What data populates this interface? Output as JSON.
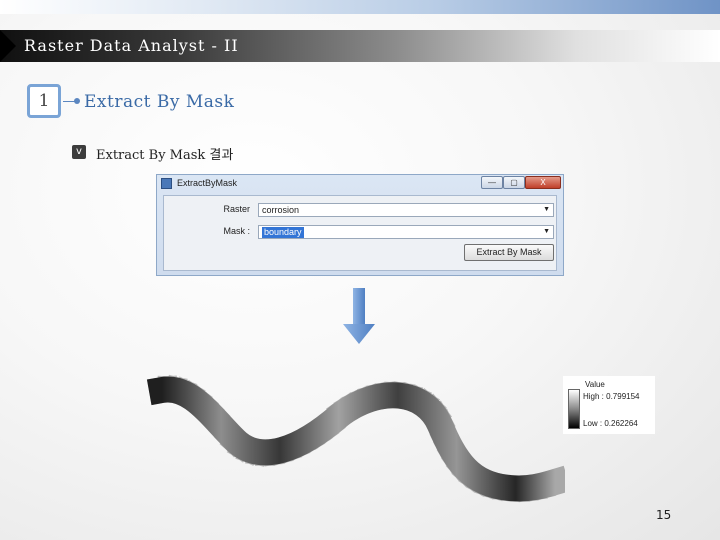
{
  "header": {
    "title": "Raster Data Analyst - II"
  },
  "section": {
    "number": "1",
    "title": "Extract By Mask"
  },
  "bullet": {
    "marker": "v",
    "text": "Extract By Mask 결과"
  },
  "dialog": {
    "title": "ExtractByMask",
    "window_buttons": {
      "minimize": "—",
      "maximize": "▢",
      "close": "X"
    },
    "fields": [
      {
        "label": "Raster",
        "value": "corrosion"
      },
      {
        "label": "Mask :",
        "value": "boundary"
      }
    ],
    "action_label": "Extract By Mask"
  },
  "legend": {
    "title": "Value",
    "high": "High : 0.799154",
    "low": "Low : 0.262264"
  },
  "page_number": "15",
  "colors": {
    "accent_blue": "#3a6aa6",
    "arrow_blue": "#6d98d6",
    "number_box_border": "#7aa4d6"
  }
}
